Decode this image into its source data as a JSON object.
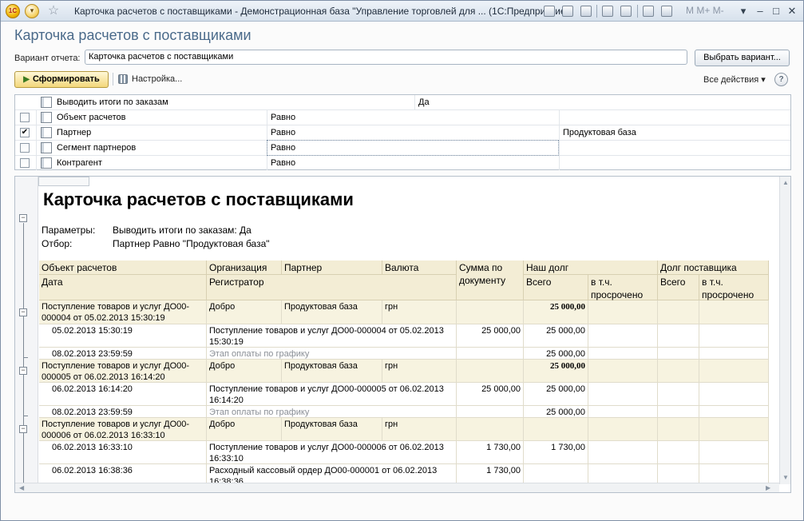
{
  "window": {
    "title": "Карточка расчетов с поставщиками - Демонстрационная база \"Управление торговлей для ...  (1С:Предприятие)",
    "logo": "1С",
    "mtext": "M  M+  M-"
  },
  "form": {
    "title": "Карточка расчетов с поставщиками",
    "variant_label": "Вариант отчета:",
    "variant_value": "Карточка расчетов с поставщиками",
    "choose_variant": "Выбрать вариант...",
    "generate": "Сформировать",
    "settings": "Настройка...",
    "all_actions": "Все действия",
    "help": "?"
  },
  "filters": [
    {
      "checkbox": false,
      "name": "Выводить итоги по заказам",
      "op": "Да",
      "value": ""
    },
    {
      "checkbox": true,
      "checked": false,
      "name": "Объект расчетов",
      "op": "Равно",
      "value": ""
    },
    {
      "checkbox": true,
      "checked": true,
      "name": "Партнер",
      "op": "Равно",
      "value": "Продуктовая база"
    },
    {
      "checkbox": true,
      "checked": false,
      "name": "Сегмент партнеров",
      "op": "Равно",
      "value": ""
    },
    {
      "checkbox": true,
      "checked": false,
      "name": "Контрагент",
      "op": "Равно",
      "value": ""
    }
  ],
  "report": {
    "title": "Карточка расчетов с поставщиками",
    "params_label": "Параметры:",
    "params_value": "Выводить итоги по заказам: Да",
    "filter_label": "Отбор:",
    "filter_value": "Партнер Равно \"Продуктовая база\"",
    "headers": {
      "obj": "Объект расчетов",
      "org": "Организация",
      "partner": "Партнер",
      "currency": "Валюта",
      "doc_sum": "Сумма по документу",
      "our_debt": "Наш долг",
      "supplier_debt": "Долг поставщика",
      "date": "Дата",
      "registrar": "Регистратор",
      "total": "Всего",
      "overdue": "в т.ч. просрочено",
      "total2": "Всего",
      "overdue2": "в т.ч. просрочено"
    },
    "groups": [
      {
        "obj": "Поступление товаров и услуг ДО00-000004 от 05.02.2013 15:30:19",
        "org": "Добро",
        "partner": "Продуктовая база",
        "currency": "грн",
        "our_total": "25 000,00",
        "rows": [
          {
            "date": "05.02.2013 15:30:19",
            "reg": "Поступление товаров и услуг ДО00-000004 от 05.02.2013 15:30:19",
            "sum": "25 000,00",
            "our": "25 000,00",
            "muted": false
          },
          {
            "date": "08.02.2013 23:59:59",
            "reg": "Этап оплаты по графику",
            "sum": "",
            "our": "25 000,00",
            "muted": true
          }
        ]
      },
      {
        "obj": "Поступление товаров и услуг ДО00-000005 от 06.02.2013 16:14:20",
        "org": "Добро",
        "partner": "Продуктовая база",
        "currency": "грн",
        "our_total": "25 000,00",
        "rows": [
          {
            "date": "06.02.2013 16:14:20",
            "reg": "Поступление товаров и услуг ДО00-000005 от 06.02.2013 16:14:20",
            "sum": "25 000,00",
            "our": "25 000,00",
            "muted": false
          },
          {
            "date": "08.02.2013 23:59:59",
            "reg": "Этап оплаты по графику",
            "sum": "",
            "our": "25 000,00",
            "muted": true
          }
        ]
      },
      {
        "obj": "Поступление товаров и услуг ДО00-000006 от 06.02.2013 16:33:10",
        "org": "Добро",
        "partner": "Продуктовая база",
        "currency": "грн",
        "our_total": "",
        "rows": [
          {
            "date": "06.02.2013 16:33:10",
            "reg": "Поступление товаров и услуг ДО00-000006 от 06.02.2013 16:33:10",
            "sum": "1 730,00",
            "our": "1 730,00",
            "muted": false
          },
          {
            "date": "06.02.2013 16:38:36",
            "reg": "Расходный кассовый ордер ДО00-000001 от 06.02.2013 16:38:36",
            "sum": "1 730,00",
            "our": "",
            "muted": false
          }
        ]
      }
    ]
  }
}
